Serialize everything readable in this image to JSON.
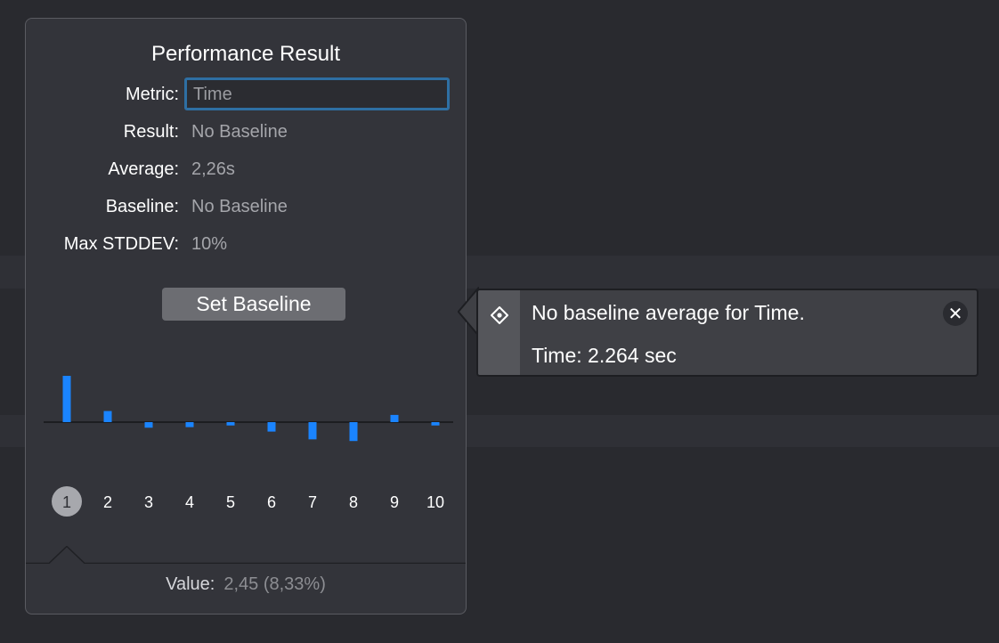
{
  "popover": {
    "title": "Performance Result",
    "metric": {
      "label": "Metric:",
      "value": "Time"
    },
    "result": {
      "label": "Result:",
      "value": "No Baseline"
    },
    "average": {
      "label": "Average:",
      "value": "2,26s"
    },
    "baseline": {
      "label": "Baseline:",
      "value": "No Baseline"
    },
    "max_stddev": {
      "label": "Max STDDEV:",
      "value": "10%"
    },
    "set_baseline_label": "Set Baseline",
    "value_label": "Value:",
    "value_text": "2,45 (8,33%)"
  },
  "chart_data": {
    "type": "bar",
    "categories": [
      "1",
      "2",
      "3",
      "4",
      "5",
      "6",
      "7",
      "8",
      "9",
      "10"
    ],
    "values": [
      8.33,
      2.0,
      -1.0,
      -0.9,
      -0.6,
      -1.7,
      -3.1,
      -3.4,
      1.3,
      -0.6
    ],
    "ylim": [
      -4,
      9
    ],
    "selected_index": 0,
    "bar_color": "#1a84ff",
    "baseline_color": "#1c1d21"
  },
  "issue": {
    "message": "No baseline average for Time.",
    "detail": "Time: 2.264 sec",
    "icon": "diamond-icon",
    "close_icon": "close-icon",
    "close_glyph": "✕"
  }
}
